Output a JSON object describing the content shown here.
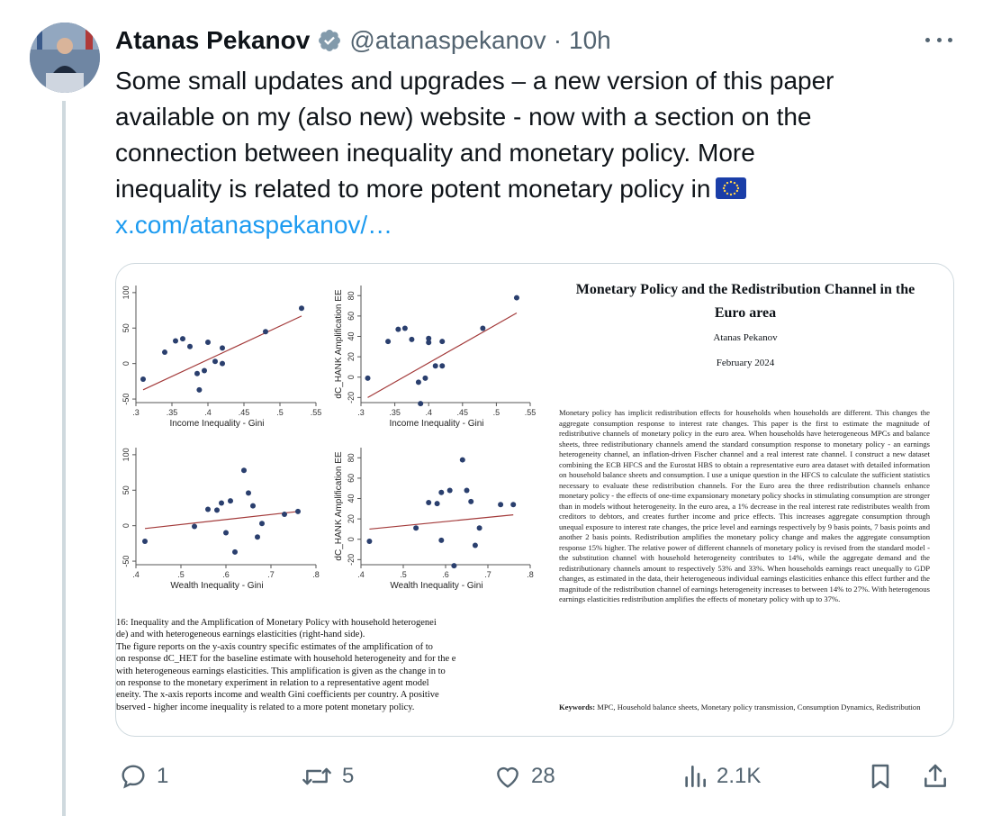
{
  "tweet": {
    "author_name": "Atanas Pekanov",
    "handle": "@atanaspekanov",
    "separator": "·",
    "time": "10h",
    "body_lines": [
      "Some small updates and upgrades – a new version of this paper",
      "available on my (also new) website - now with a section on the",
      "connection between inequality and monetary policy. More",
      "inequality is related to more potent monetary policy in"
    ],
    "link": "x.com/atanaspekanov/…",
    "flag_icon": "eu-flag-icon"
  },
  "paper": {
    "title_line1": "Monetary Policy and the Redistribution Channel in the",
    "title_line2": "Euro area",
    "author": "Atanas Pekanov",
    "date": "February 2024",
    "abstract": "Monetary policy has implicit redistribution effects for households when households are different. This changes the aggregate consumption response to interest rate changes. This paper is the first to estimate the magnitude of redistributive channels of monetary policy in the euro area. When households have heterogeneous MPCs and balance sheets, three redistributionary channels amend the standard consumption response to monetary policy - an earnings heterogeneity channel, an inflation-driven Fischer channel and a real interest rate channel. I construct a new dataset combining the ECB HFCS and the Eurostat HBS to obtain a representative euro area dataset with detailed information on household balance sheets and consumption. I use a unique question in the HFCS to calculate the sufficient statistics necessary to evaluate these redistribution channels. For the Euro area the three redistribution channels enhance monetary policy - the effects of one-time expansionary monetary policy shocks in stimulating consumption are stronger than in models without heterogeneity. In the euro area, a 1% decrease in the real interest rate redistributes wealth from creditors to debtors, and creates further income and price effects. This increases aggregate consumption through unequal exposure to interest rate changes, the price level and earnings respectively by 9 basis points, 7 basis points and another 2 basis points. Redistribution amplifies the monetary policy change and makes the aggregate consumption response 15% higher. The relative power of different channels of monetary policy is revised from the standard model - the substitution channel with household heterogeneity contributes to 14%, while the aggregate demand and the redistributionary channels amount to respectively 53% and 33%. When households earnings react unequally to GDP changes, as estimated in the data, their heterogeneous individual earnings elasticities enhance this effect further and the magnitude of the redistribution channel of earnings heterogeneity increases to between 14% to 27%. With heterogenous earnings elasticities redistribution amplifies the effects of monetary policy with up to 37%.",
    "keywords_label": "Keywords:",
    "keywords": "MPC, Household balance sheets, Monetary policy transmission, Consumption Dynamics, Redistribution"
  },
  "caption_lines": [
    "16: Inequality and the Amplification of Monetary Policy with household heterogenei",
    "de) and with heterogeneous earnings elasticities (right-hand side).",
    "The figure reports on the y-axis country specific estimates of the amplification of to",
    "on response dC_HET for the baseline estimate with household heterogeneity and for the e",
    "with heterogeneous earnings elasticities. This amplification is given as the change in to",
    "on response to the monetary experiment in relation to a representative agent model",
    "eneity. The x-axis reports income and wealth Gini coefficients per country. A positive",
    "bserved - higher income inequality is related to a more potent monetary policy."
  ],
  "chart_data": [
    {
      "type": "scatter",
      "xlabel": "Income Inequality - Gini",
      "ylabel": "",
      "xticks": [
        ".3",
        ".35",
        ".4",
        ".45",
        ".5",
        ".55"
      ],
      "yticks": [
        "-50",
        "0",
        "50",
        "100"
      ],
      "xlim": [
        0.3,
        0.55
      ],
      "ylim": [
        -55,
        110
      ],
      "x": [
        0.31,
        0.34,
        0.355,
        0.365,
        0.375,
        0.385,
        0.388,
        0.395,
        0.4,
        0.41,
        0.42,
        0.42,
        0.48,
        0.53
      ],
      "y": [
        -22,
        16,
        32,
        35,
        24,
        -14,
        -37,
        -10,
        30,
        3,
        22,
        0,
        45,
        78
      ],
      "fit": [
        [
          0.31,
          -37
        ],
        [
          0.53,
          67
        ]
      ],
      "point_color": "#2a3f6e",
      "fit_color": "#a33a3a"
    },
    {
      "type": "scatter",
      "xlabel": "Income Inequality - Gini",
      "ylabel": "dC_HANK Amplification EE",
      "xticks": [
        ".3",
        ".35",
        ".4",
        ".45",
        ".5",
        ".55"
      ],
      "yticks": [
        "-20",
        "0",
        "20",
        "40",
        "60",
        "80"
      ],
      "xlim": [
        0.3,
        0.55
      ],
      "ylim": [
        -25,
        90
      ],
      "x": [
        0.31,
        0.34,
        0.355,
        0.365,
        0.375,
        0.385,
        0.388,
        0.395,
        0.4,
        0.4,
        0.41,
        0.42,
        0.42,
        0.48,
        0.53
      ],
      "y": [
        -1,
        35,
        47,
        48,
        37,
        -5,
        -26,
        -1,
        38,
        34,
        11,
        35,
        11,
        48,
        78
      ],
      "fit": [
        [
          0.31,
          -20
        ],
        [
          0.53,
          63
        ]
      ],
      "point_color": "#2a3f6e",
      "fit_color": "#a33a3a"
    },
    {
      "type": "scatter",
      "xlabel": "Wealth Inequality - Gini",
      "ylabel": "",
      "xticks": [
        ".4",
        ".5",
        ".6",
        ".7",
        ".8"
      ],
      "yticks": [
        "-50",
        "0",
        "50",
        "100"
      ],
      "xlim": [
        0.4,
        0.8
      ],
      "ylim": [
        -55,
        110
      ],
      "x": [
        0.42,
        0.53,
        0.56,
        0.58,
        0.59,
        0.6,
        0.61,
        0.62,
        0.64,
        0.65,
        0.66,
        0.67,
        0.68,
        0.73,
        0.76
      ],
      "y": [
        -22,
        -1,
        23,
        22,
        32,
        -10,
        35,
        -37,
        78,
        46,
        28,
        -16,
        3,
        16,
        20
      ],
      "fit": [
        [
          0.42,
          -4
        ],
        [
          0.76,
          20
        ]
      ],
      "point_color": "#2a3f6e",
      "fit_color": "#a33a3a"
    },
    {
      "type": "scatter",
      "xlabel": "Wealth Inequality - Gini",
      "ylabel": "dC_HANK Amplification EE",
      "xticks": [
        ".4",
        ".5",
        ".6",
        ".7",
        ".8"
      ],
      "yticks": [
        "-20",
        "0",
        "20",
        "40",
        "60",
        "80"
      ],
      "xlim": [
        0.4,
        0.8
      ],
      "ylim": [
        -25,
        90
      ],
      "x": [
        0.42,
        0.53,
        0.56,
        0.58,
        0.59,
        0.59,
        0.61,
        0.62,
        0.64,
        0.65,
        0.66,
        0.67,
        0.68,
        0.73,
        0.76
      ],
      "y": [
        -2,
        11,
        36,
        35,
        46,
        -1,
        48,
        -26,
        78,
        48,
        37,
        -6,
        11,
        34,
        34
      ],
      "fit": [
        [
          0.42,
          10
        ],
        [
          0.76,
          24
        ]
      ],
      "point_color": "#2a3f6e",
      "fit_color": "#a33a3a"
    }
  ],
  "actions": {
    "reply_count": "1",
    "retweet_count": "5",
    "like_count": "28",
    "views_count": "2.1K"
  },
  "colors": {
    "accent": "#1d9bf0",
    "muted": "#536471",
    "border": "#cfd9de"
  }
}
